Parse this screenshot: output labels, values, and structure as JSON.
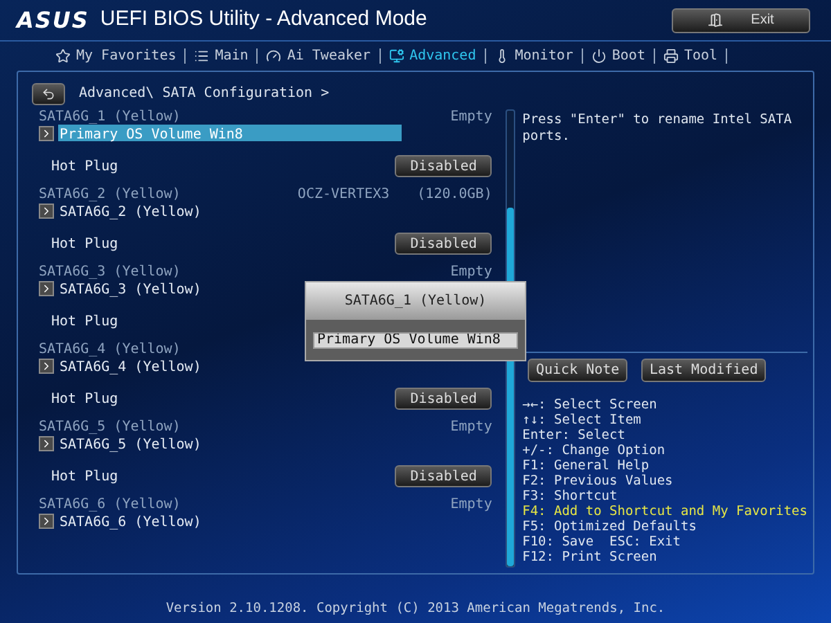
{
  "header": {
    "logo": "ASUS",
    "title": "UEFI BIOS Utility - Advanced Mode",
    "exit_button": "Exit"
  },
  "tabs": [
    {
      "label": "My Favorites",
      "selected": false
    },
    {
      "label": "Main",
      "selected": false
    },
    {
      "label": "Ai Tweaker",
      "selected": false
    },
    {
      "label": "Advanced",
      "selected": true
    },
    {
      "label": "Monitor",
      "selected": false
    },
    {
      "label": "Boot",
      "selected": false
    },
    {
      "label": "Tool",
      "selected": false
    }
  ],
  "breadcrumb": "Advanced\\ SATA Configuration >",
  "ports": [
    {
      "label": "SATA6G_1 (Yellow)",
      "status": "Empty",
      "name": "Primary OS Volume Win8",
      "selected": true,
      "hot_plug": {
        "label": "Hot Plug",
        "value": "Disabled"
      }
    },
    {
      "label": "SATA6G_2 (Yellow)",
      "status": "OCZ-VERTEX3",
      "capacity": "(120.0GB)",
      "name": "SATA6G_2 (Yellow)",
      "selected": false,
      "hot_plug": {
        "label": "Hot Plug",
        "value": "Disabled"
      }
    },
    {
      "label": "SATA6G_3 (Yellow)",
      "status": "Empty",
      "name": "SATA6G_3 (Yellow)",
      "selected": false,
      "hot_plug": {
        "label": "Hot Plug"
      }
    },
    {
      "label": "SATA6G_4 (Yellow)",
      "name": "SATA6G_4 (Yellow)",
      "selected": false,
      "hot_plug": {
        "label": "Hot Plug",
        "value": "Disabled"
      }
    },
    {
      "label": "SATA6G_5 (Yellow)",
      "status": "Empty",
      "name": "SATA6G_5 (Yellow)",
      "selected": false,
      "hot_plug": {
        "label": "Hot Plug",
        "value": "Disabled"
      }
    },
    {
      "label": "SATA6G_6 (Yellow)",
      "status": "Empty",
      "name": "SATA6G_6 (Yellow)",
      "selected": false
    }
  ],
  "rename_dialog": {
    "title": "SATA6G_1 (Yellow)",
    "value": "Primary OS Volume Win8"
  },
  "help": {
    "text": "Press \"Enter\" to rename Intel SATA ports."
  },
  "buttons": [
    "Quick Note",
    "Last Modified"
  ],
  "key_hints": [
    {
      "text": "→←: Select Screen",
      "highlighted": false
    },
    {
      "text": "↑↓: Select Item",
      "highlighted": false
    },
    {
      "text": "Enter: Select",
      "highlighted": false
    },
    {
      "text": "+/-: Change Option",
      "highlighted": false
    },
    {
      "text": "F1: General Help",
      "highlighted": false
    },
    {
      "text": "F2: Previous Values",
      "highlighted": false
    },
    {
      "text": "F3: Shortcut",
      "highlighted": false
    },
    {
      "text": "F4: Add to Shortcut and My Favorites",
      "highlighted": true
    },
    {
      "text": "F5: Optimized Defaults",
      "highlighted": false
    },
    {
      "text": "F10: Save  ESC: Exit",
      "highlighted": false
    },
    {
      "text": "F12: Print Screen",
      "highlighted": false
    }
  ],
  "footer": "Version 2.10.1208. Copyright (C) 2013 American Megatrends, Inc."
}
